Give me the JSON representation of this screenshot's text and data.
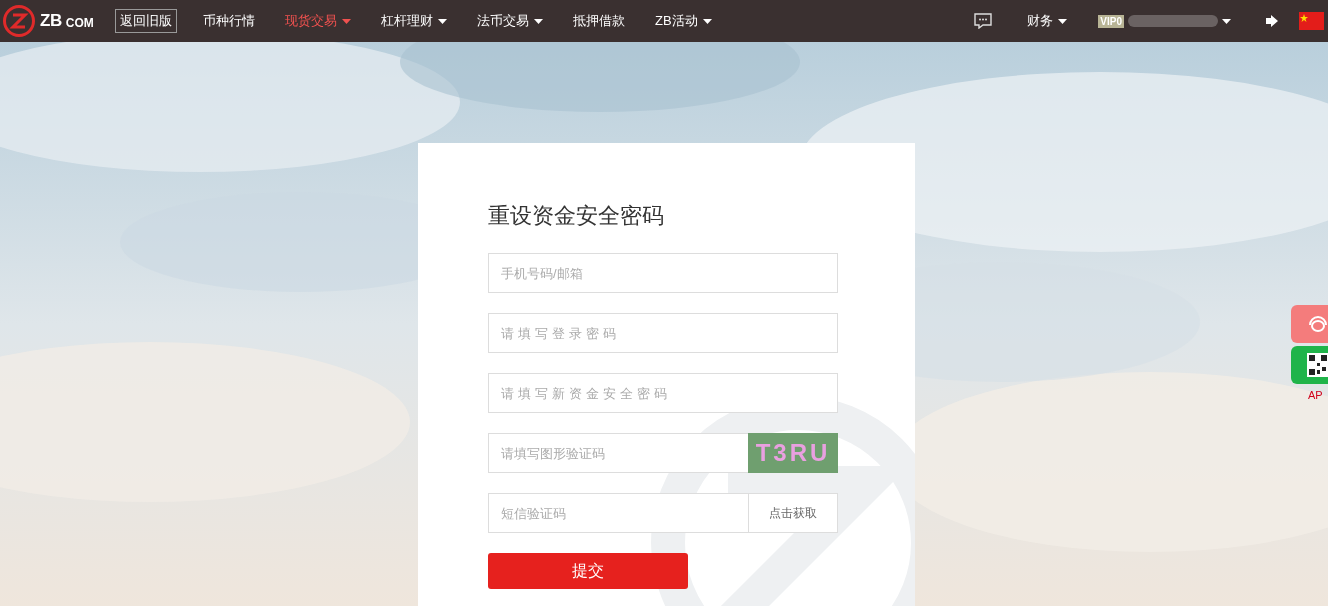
{
  "header": {
    "logo": {
      "brand": "ZB",
      "suffix": "COM"
    },
    "old_version": "返回旧版",
    "nav": [
      {
        "label": "币种行情",
        "selected": false,
        "dropdown": false
      },
      {
        "label": "现货交易",
        "selected": true,
        "dropdown": true
      },
      {
        "label": "杠杆理财",
        "selected": false,
        "dropdown": true
      },
      {
        "label": "法币交易",
        "selected": false,
        "dropdown": true
      },
      {
        "label": "抵押借款",
        "selected": false,
        "dropdown": false
      },
      {
        "label": "ZB活动",
        "selected": false,
        "dropdown": true
      }
    ],
    "finance": {
      "label": "财务",
      "dropdown": true
    },
    "account": {
      "vip": "VIP0",
      "dropdown": true
    }
  },
  "form": {
    "title": "重设资金安全密码",
    "fields": [
      {
        "kind": "plain",
        "placeholder": "手机号码/邮箱",
        "spaced": false
      },
      {
        "kind": "plain",
        "placeholder": "请填写登录密码",
        "spaced": true
      },
      {
        "kind": "plain",
        "placeholder": "请填写新资金安全密码",
        "spaced": true
      },
      {
        "kind": "captcha",
        "placeholder": "请填写图形验证码",
        "spaced": false,
        "captcha": "T3RU"
      },
      {
        "kind": "sms",
        "placeholder": "短信验证码",
        "spaced": false,
        "action": "点击获取"
      }
    ],
    "submit": "提交"
  },
  "side_widgets": {
    "app_label": "AP"
  }
}
